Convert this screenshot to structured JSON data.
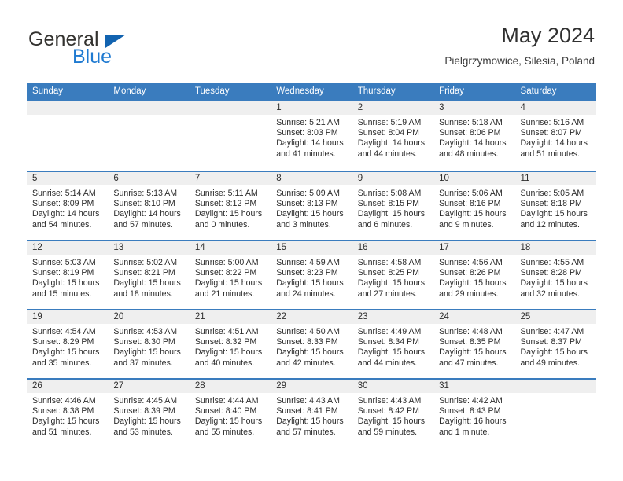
{
  "brand": {
    "word_one": "General",
    "word_two": "Blue",
    "accent_color": "#1263b0",
    "blue_text_color": "#1f7ad1"
  },
  "header": {
    "title": "May 2024",
    "location": "Pielgrzymowice, Silesia, Poland"
  },
  "calendar": {
    "header_color": "#3a7cbe",
    "weekdays": [
      "Sunday",
      "Monday",
      "Tuesday",
      "Wednesday",
      "Thursday",
      "Friday",
      "Saturday"
    ],
    "weeks": [
      [
        {
          "day": "",
          "sunrise": "",
          "sunset": "",
          "daylight_line1": "",
          "daylight_line2": "",
          "empty": true
        },
        {
          "day": "",
          "sunrise": "",
          "sunset": "",
          "daylight_line1": "",
          "daylight_line2": "",
          "empty": true
        },
        {
          "day": "",
          "sunrise": "",
          "sunset": "",
          "daylight_line1": "",
          "daylight_line2": "",
          "empty": true
        },
        {
          "day": "1",
          "sunrise": "Sunrise: 5:21 AM",
          "sunset": "Sunset: 8:03 PM",
          "daylight_line1": "Daylight: 14 hours",
          "daylight_line2": "and 41 minutes."
        },
        {
          "day": "2",
          "sunrise": "Sunrise: 5:19 AM",
          "sunset": "Sunset: 8:04 PM",
          "daylight_line1": "Daylight: 14 hours",
          "daylight_line2": "and 44 minutes."
        },
        {
          "day": "3",
          "sunrise": "Sunrise: 5:18 AM",
          "sunset": "Sunset: 8:06 PM",
          "daylight_line1": "Daylight: 14 hours",
          "daylight_line2": "and 48 minutes."
        },
        {
          "day": "4",
          "sunrise": "Sunrise: 5:16 AM",
          "sunset": "Sunset: 8:07 PM",
          "daylight_line1": "Daylight: 14 hours",
          "daylight_line2": "and 51 minutes."
        }
      ],
      [
        {
          "day": "5",
          "sunrise": "Sunrise: 5:14 AM",
          "sunset": "Sunset: 8:09 PM",
          "daylight_line1": "Daylight: 14 hours",
          "daylight_line2": "and 54 minutes."
        },
        {
          "day": "6",
          "sunrise": "Sunrise: 5:13 AM",
          "sunset": "Sunset: 8:10 PM",
          "daylight_line1": "Daylight: 14 hours",
          "daylight_line2": "and 57 minutes."
        },
        {
          "day": "7",
          "sunrise": "Sunrise: 5:11 AM",
          "sunset": "Sunset: 8:12 PM",
          "daylight_line1": "Daylight: 15 hours",
          "daylight_line2": "and 0 minutes."
        },
        {
          "day": "8",
          "sunrise": "Sunrise: 5:09 AM",
          "sunset": "Sunset: 8:13 PM",
          "daylight_line1": "Daylight: 15 hours",
          "daylight_line2": "and 3 minutes."
        },
        {
          "day": "9",
          "sunrise": "Sunrise: 5:08 AM",
          "sunset": "Sunset: 8:15 PM",
          "daylight_line1": "Daylight: 15 hours",
          "daylight_line2": "and 6 minutes."
        },
        {
          "day": "10",
          "sunrise": "Sunrise: 5:06 AM",
          "sunset": "Sunset: 8:16 PM",
          "daylight_line1": "Daylight: 15 hours",
          "daylight_line2": "and 9 minutes."
        },
        {
          "day": "11",
          "sunrise": "Sunrise: 5:05 AM",
          "sunset": "Sunset: 8:18 PM",
          "daylight_line1": "Daylight: 15 hours",
          "daylight_line2": "and 12 minutes."
        }
      ],
      [
        {
          "day": "12",
          "sunrise": "Sunrise: 5:03 AM",
          "sunset": "Sunset: 8:19 PM",
          "daylight_line1": "Daylight: 15 hours",
          "daylight_line2": "and 15 minutes."
        },
        {
          "day": "13",
          "sunrise": "Sunrise: 5:02 AM",
          "sunset": "Sunset: 8:21 PM",
          "daylight_line1": "Daylight: 15 hours",
          "daylight_line2": "and 18 minutes."
        },
        {
          "day": "14",
          "sunrise": "Sunrise: 5:00 AM",
          "sunset": "Sunset: 8:22 PM",
          "daylight_line1": "Daylight: 15 hours",
          "daylight_line2": "and 21 minutes."
        },
        {
          "day": "15",
          "sunrise": "Sunrise: 4:59 AM",
          "sunset": "Sunset: 8:23 PM",
          "daylight_line1": "Daylight: 15 hours",
          "daylight_line2": "and 24 minutes."
        },
        {
          "day": "16",
          "sunrise": "Sunrise: 4:58 AM",
          "sunset": "Sunset: 8:25 PM",
          "daylight_line1": "Daylight: 15 hours",
          "daylight_line2": "and 27 minutes."
        },
        {
          "day": "17",
          "sunrise": "Sunrise: 4:56 AM",
          "sunset": "Sunset: 8:26 PM",
          "daylight_line1": "Daylight: 15 hours",
          "daylight_line2": "and 29 minutes."
        },
        {
          "day": "18",
          "sunrise": "Sunrise: 4:55 AM",
          "sunset": "Sunset: 8:28 PM",
          "daylight_line1": "Daylight: 15 hours",
          "daylight_line2": "and 32 minutes."
        }
      ],
      [
        {
          "day": "19",
          "sunrise": "Sunrise: 4:54 AM",
          "sunset": "Sunset: 8:29 PM",
          "daylight_line1": "Daylight: 15 hours",
          "daylight_line2": "and 35 minutes."
        },
        {
          "day": "20",
          "sunrise": "Sunrise: 4:53 AM",
          "sunset": "Sunset: 8:30 PM",
          "daylight_line1": "Daylight: 15 hours",
          "daylight_line2": "and 37 minutes."
        },
        {
          "day": "21",
          "sunrise": "Sunrise: 4:51 AM",
          "sunset": "Sunset: 8:32 PM",
          "daylight_line1": "Daylight: 15 hours",
          "daylight_line2": "and 40 minutes."
        },
        {
          "day": "22",
          "sunrise": "Sunrise: 4:50 AM",
          "sunset": "Sunset: 8:33 PM",
          "daylight_line1": "Daylight: 15 hours",
          "daylight_line2": "and 42 minutes."
        },
        {
          "day": "23",
          "sunrise": "Sunrise: 4:49 AM",
          "sunset": "Sunset: 8:34 PM",
          "daylight_line1": "Daylight: 15 hours",
          "daylight_line2": "and 44 minutes."
        },
        {
          "day": "24",
          "sunrise": "Sunrise: 4:48 AM",
          "sunset": "Sunset: 8:35 PM",
          "daylight_line1": "Daylight: 15 hours",
          "daylight_line2": "and 47 minutes."
        },
        {
          "day": "25",
          "sunrise": "Sunrise: 4:47 AM",
          "sunset": "Sunset: 8:37 PM",
          "daylight_line1": "Daylight: 15 hours",
          "daylight_line2": "and 49 minutes."
        }
      ],
      [
        {
          "day": "26",
          "sunrise": "Sunrise: 4:46 AM",
          "sunset": "Sunset: 8:38 PM",
          "daylight_line1": "Daylight: 15 hours",
          "daylight_line2": "and 51 minutes."
        },
        {
          "day": "27",
          "sunrise": "Sunrise: 4:45 AM",
          "sunset": "Sunset: 8:39 PM",
          "daylight_line1": "Daylight: 15 hours",
          "daylight_line2": "and 53 minutes."
        },
        {
          "day": "28",
          "sunrise": "Sunrise: 4:44 AM",
          "sunset": "Sunset: 8:40 PM",
          "daylight_line1": "Daylight: 15 hours",
          "daylight_line2": "and 55 minutes."
        },
        {
          "day": "29",
          "sunrise": "Sunrise: 4:43 AM",
          "sunset": "Sunset: 8:41 PM",
          "daylight_line1": "Daylight: 15 hours",
          "daylight_line2": "and 57 minutes."
        },
        {
          "day": "30",
          "sunrise": "Sunrise: 4:43 AM",
          "sunset": "Sunset: 8:42 PM",
          "daylight_line1": "Daylight: 15 hours",
          "daylight_line2": "and 59 minutes."
        },
        {
          "day": "31",
          "sunrise": "Sunrise: 4:42 AM",
          "sunset": "Sunset: 8:43 PM",
          "daylight_line1": "Daylight: 16 hours",
          "daylight_line2": "and 1 minute."
        },
        {
          "day": "",
          "sunrise": "",
          "sunset": "",
          "daylight_line1": "",
          "daylight_line2": "",
          "empty": true
        }
      ]
    ]
  }
}
